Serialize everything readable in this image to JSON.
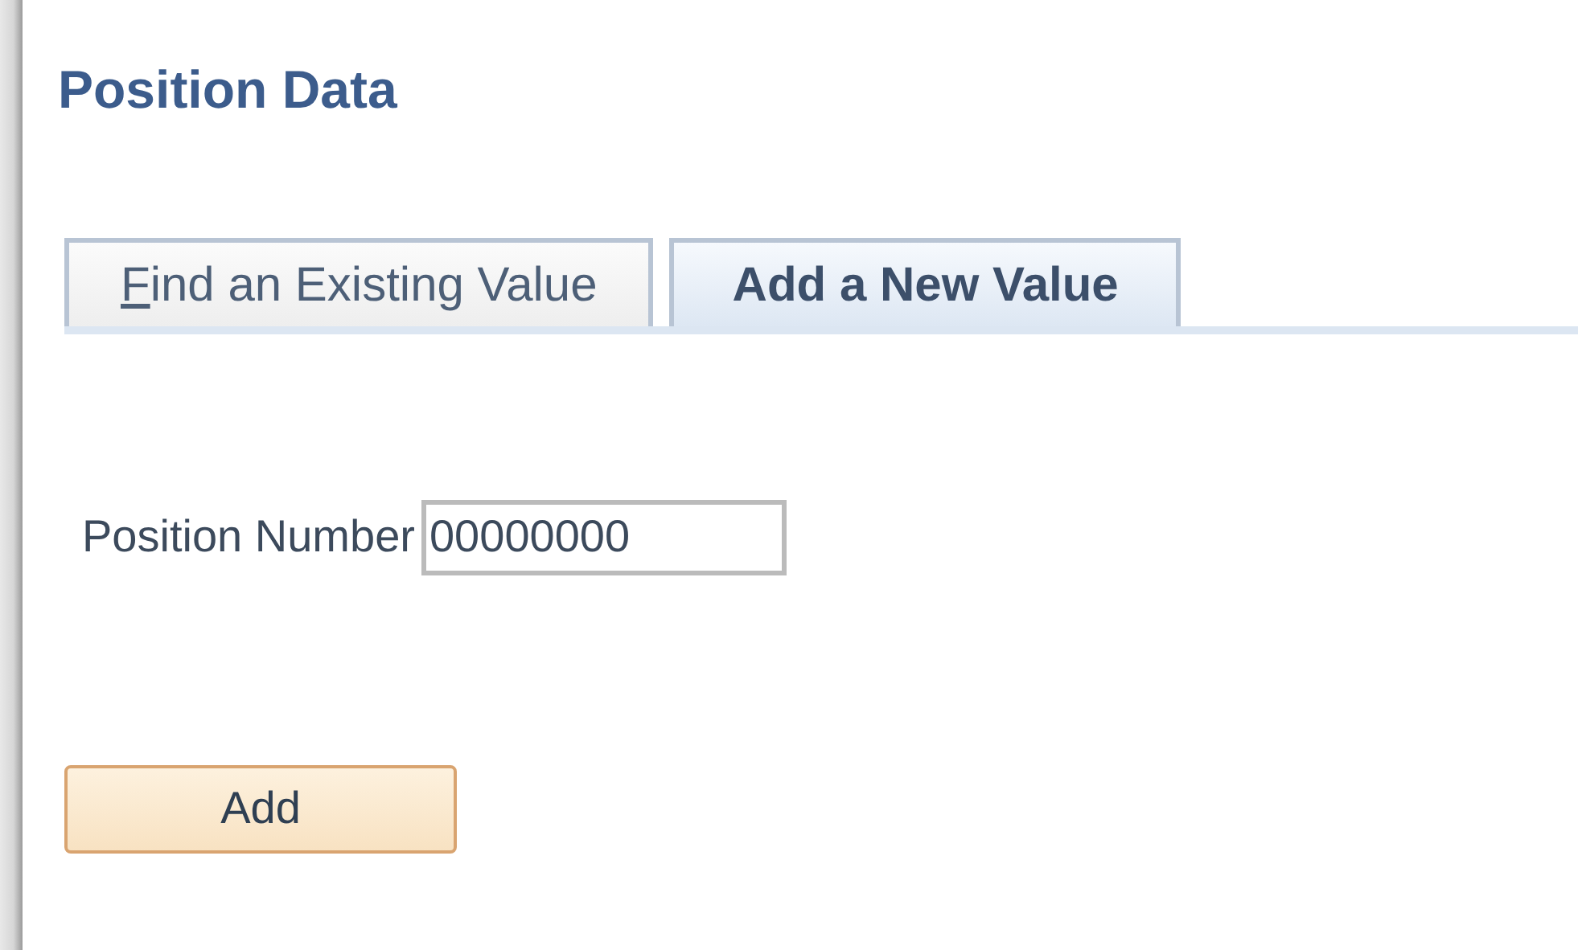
{
  "page_title": "Position Data",
  "tabs": [
    {
      "label": "Find an Existing Value",
      "selected": false,
      "mnemonic": true
    },
    {
      "label": "Add a New Value",
      "selected": true,
      "mnemonic": false
    }
  ],
  "field": {
    "label": "Position Number",
    "value": "00000000"
  },
  "button": {
    "label": "Add"
  }
}
